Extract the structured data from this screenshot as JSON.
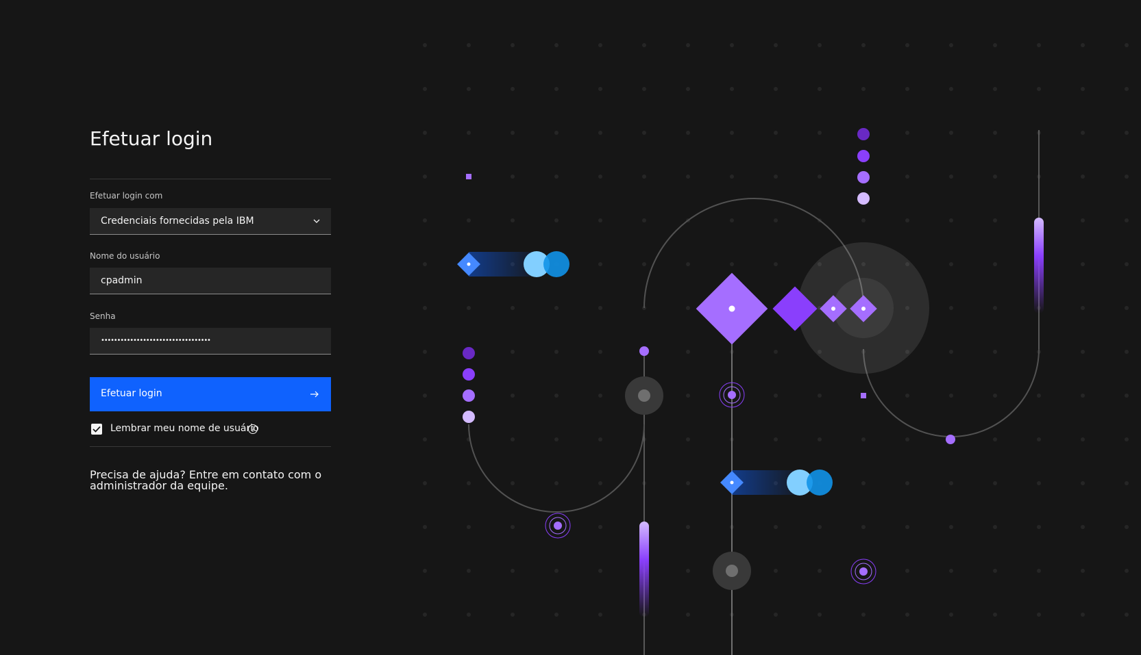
{
  "page": {
    "title": "Efetuar login"
  },
  "login_method": {
    "label": "Efetuar login com",
    "value": "Credenciais fornecidas pela IBM",
    "icon": "chevron-down-icon"
  },
  "username": {
    "label": "Nome do usuário",
    "value": "cpadmin"
  },
  "password": {
    "label": "Senha",
    "value": "••••••••••••••••••••••••••••••••••"
  },
  "submit": {
    "label": "Efetuar login",
    "icon": "arrow-right-icon"
  },
  "remember": {
    "label": "Lembrar meu nome de usuário",
    "checked": true,
    "icon": "info-icon"
  },
  "help": {
    "text": "Precisa de ajuda? Entre em contato com o administrador da equipe."
  },
  "colors": {
    "background": "#161616",
    "primary": "#0f62fe",
    "field": "#262626",
    "purple": "#8a3ffc",
    "light_purple": "#a56eff",
    "blue": "#4589ff",
    "cyan": "#82cfff"
  }
}
